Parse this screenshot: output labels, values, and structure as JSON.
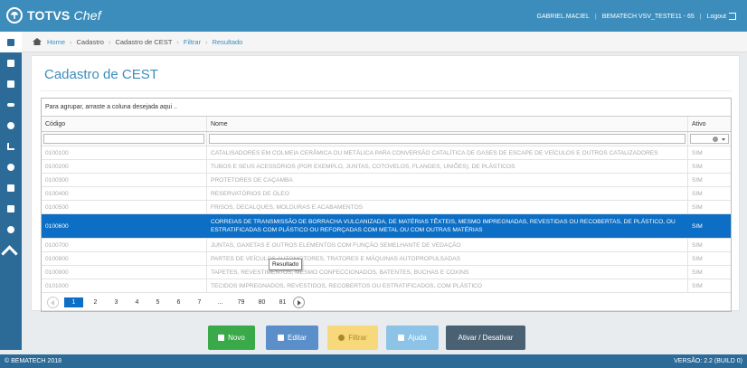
{
  "header": {
    "brand": "TOTVS",
    "brand_suffix": "Chef",
    "user": "GABRIEL.MACIEL",
    "environment": "BEMATECH VSV_TESTE11 - 65",
    "logout": "Logout"
  },
  "breadcrumb": [
    "Home",
    "Cadastro",
    "Cadastro de CEST",
    "Filtrar",
    "Resultado"
  ],
  "page": {
    "title": "Cadastro de CEST"
  },
  "grid": {
    "group_hint": "Para agrupar, arraste a coluna desejada aqui ..",
    "columns": [
      "Código",
      "Nome",
      "Ativo"
    ],
    "rows": [
      {
        "codigo": "0100100",
        "nome": "CATALISADORES EM COLMEIA CERÂMICA OU METÁLICA PARA CONVERSÃO CATALÍTICA DE GASES DE ESCAPE DE VEÍCULOS E OUTROS CATALIZADORES",
        "ativo": "SIM"
      },
      {
        "codigo": "0100200",
        "nome": "TUBOS E SEUS ACESSÓRIOS (POR EXEMPLO, JUNTAS, COTOVELOS, FLANGES, UNIÕES), DE PLÁSTICOS",
        "ativo": "SIM"
      },
      {
        "codigo": "0100300",
        "nome": "PROTETORES DE CAÇAMBA",
        "ativo": "SIM"
      },
      {
        "codigo": "0100400",
        "nome": "RESERVATÓRIOS DE ÓLEO",
        "ativo": "SIM"
      },
      {
        "codigo": "0100500",
        "nome": "FRISOS, DECALQUES, MOLDURAS E ACABAMENTOS",
        "ativo": "SIM"
      },
      {
        "codigo": "0100600",
        "nome": "CORREIAS DE TRANSMISSÃO DE BORRACHA VULCANIZADA, DE MATÉRIAS TÊXTEIS, MESMO IMPREGNADAS, REVESTIDAS OU RECOBERTAS, DE PLÁSTICO, OU ESTRATIFICADAS COM PLÁSTICO OU REFORÇADAS COM METAL OU COM OUTRAS MATÉRIAS",
        "ativo": "SIM"
      },
      {
        "codigo": "0100700",
        "nome": "JUNTAS, GAXETAS E OUTROS ELEMENTOS COM FUNÇÃO SEMELHANTE DE VEDAÇÃO",
        "ativo": "SIM"
      },
      {
        "codigo": "0100800",
        "nome": "PARTES DE VEÍCULOS AUTOMOTORES, TRATORES E MÁQUINAS AUTOPROPULSADAS",
        "ativo": "SIM"
      },
      {
        "codigo": "0100900",
        "nome": "TAPETES, REVESTIMENTOS, MESMO CONFECCIONADOS, BATENTES, BUCHAS E COXINS",
        "ativo": "SIM"
      },
      {
        "codigo": "0101000",
        "nome": "TECIDOS IMPREGNADOS, REVESTIDOS, RECOBERTOS OU ESTRATIFICADOS, COM PLÁSTICO",
        "ativo": "SIM"
      }
    ],
    "pages": [
      "1",
      "2",
      "3",
      "4",
      "5",
      "6",
      "7",
      "...",
      "79",
      "80",
      "81"
    ]
  },
  "tooltip": "Resultado",
  "actions": {
    "novo": "Novo",
    "editar": "Editar",
    "filtrar": "Filtrar",
    "ajuda": "Ajuda",
    "ativar": "Ativar / Desativar"
  },
  "footer": {
    "copyright": "© BEMATECH 2018",
    "version": "VERSÃO: 2.2 (BUILD 0)"
  },
  "colors": {
    "topbar": "#3c8dbc",
    "sidebar": "#2c6a98",
    "selected_row": "#0c6ec4",
    "novo": "#3aa94a",
    "editar": "#5b8fc9",
    "filtrar": "#f7d97b",
    "ajuda": "#8cc3e6",
    "ativar": "#4a6174"
  }
}
